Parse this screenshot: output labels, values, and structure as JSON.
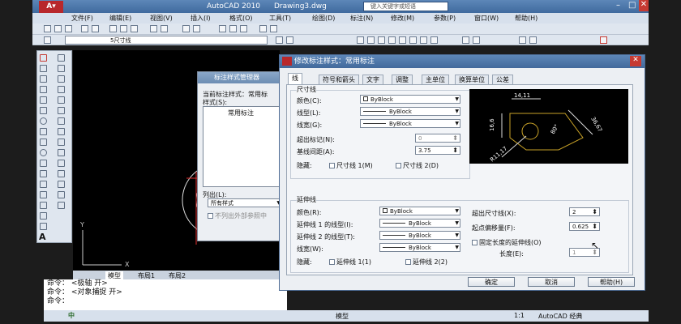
{
  "app": {
    "name": "AutoCAD 2010",
    "file": "Drawing3.dwg",
    "search_placeholder": "键入关键字或短语"
  },
  "menu": [
    "文件(F)",
    "编辑(E)",
    "视图(V)",
    "插入(I)",
    "格式(O)",
    "工具(T)",
    "绘图(D)",
    "标注(N)",
    "修改(M)",
    "参数(P)",
    "窗口(W)",
    "帮助(H)"
  ],
  "layer": {
    "name": "5尺寸线"
  },
  "model_tabs": [
    "模型",
    "布局1",
    "布局2"
  ],
  "command_lines": [
    "命令：  <极轴 开>",
    "命令：  <对象捕捉 开>",
    "命令："
  ],
  "status": {
    "model": "模型",
    "scale": "1:1",
    "workspace": "AutoCAD 经典"
  },
  "manager": {
    "title": "标注样式管理器",
    "current_label": "当前标注样式：常用标",
    "styles_label": "样式(S):",
    "style_item": "常用标注",
    "list_label": "列出(L):",
    "list_value": "所有样式",
    "exclude_xref": "不列出外部参照中"
  },
  "dialog": {
    "title": "修改标注样式：常用标注",
    "tabs": [
      "线",
      "符号和箭头",
      "文字",
      "调整",
      "主单位",
      "换算单位",
      "公差"
    ],
    "dimline": {
      "group": "尺寸线",
      "color_label": "颜色(C):",
      "color_value": "ByBlock",
      "linetype_label": "线型(L):",
      "linetype_value": "ByBlock",
      "lineweight_label": "线宽(G):",
      "lineweight_value": "ByBlock",
      "extend_label": "超出标记(N):",
      "extend_value": "0",
      "baseline_label": "基线间距(A):",
      "baseline_value": "3.75",
      "suppress_label": "隐藏:",
      "suppress1": "尺寸线 1(M)",
      "suppress2": "尺寸线 2(D)"
    },
    "extline": {
      "group": "延伸线",
      "color_label": "颜色(R):",
      "color_value": "ByBlock",
      "lt1_label": "延伸线 1 的线型(I):",
      "lt1_value": "ByBlock",
      "lt2_label": "延伸线 2 的线型(T):",
      "lt2_value": "ByBlock",
      "lw_label": "线宽(W):",
      "lw_value": "ByBlock",
      "suppress_label": "隐藏:",
      "suppress1": "延伸线 1(1)",
      "suppress2": "延伸线 2(2)",
      "beyond_label": "超出尺寸线(X):",
      "beyond_value": "2",
      "offset_label": "起点偏移量(F):",
      "offset_value": "0.625",
      "fixed_label": "固定长度的延伸线(O)",
      "length_label": "长度(E):",
      "length_value": "1"
    },
    "preview": {
      "dim_top": "14,11",
      "dim_left": "16,6",
      "dim_right": "36,67",
      "dim_angle": "80°",
      "dim_radius": "R11,17"
    },
    "buttons": {
      "ok": "确定",
      "cancel": "取消",
      "help": "帮助(H)"
    }
  }
}
